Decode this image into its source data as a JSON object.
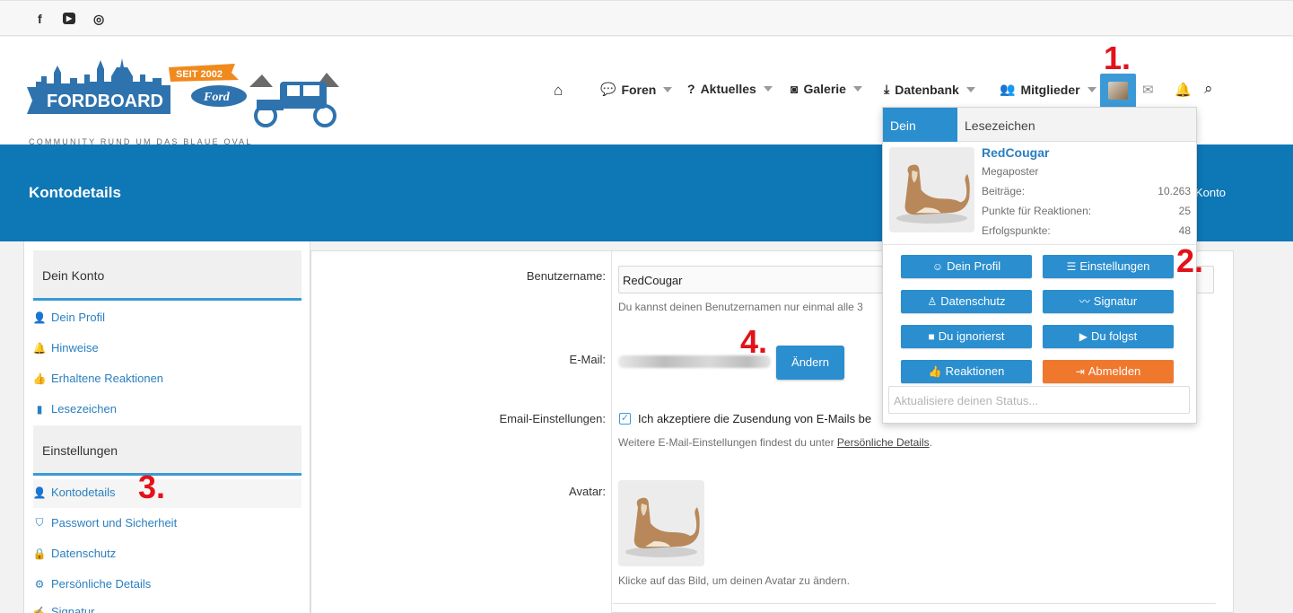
{
  "social": {
    "facebook": "f",
    "youtube": "▶",
    "instagram": "◎"
  },
  "logo": {
    "brand": "FORDBOARD",
    "ford": "Ford",
    "since": "SEIT 2002",
    "tagline": "COMMUNITY RUND UM DAS BLAUE OVAL"
  },
  "nav": {
    "home_icon": "home-icon",
    "forums": "Foren",
    "news": "Aktuelles",
    "gallery": "Galerie",
    "database": "Datenbank",
    "members": "Mitglieder"
  },
  "annotations": {
    "one": "1.",
    "two": "2.",
    "three": "3.",
    "four": "4."
  },
  "banner": {
    "title": "Kontodetails",
    "crumb": "Konto"
  },
  "sidebar": {
    "section1": "Dein Konto",
    "links1": [
      "Dein Profil",
      "Hinweise",
      "Erhaltene Reaktionen",
      "Lesezeichen"
    ],
    "section2": "Einstellungen",
    "links2": [
      "Kontodetails",
      "Passwort und Sicherheit",
      "Datenschutz",
      "Persönliche Details",
      "Signatur"
    ]
  },
  "form": {
    "username_label": "Benutzername:",
    "username_value": "RedCougar",
    "username_hint": "Du kannst deinen Benutzernamen nur einmal alle 3",
    "email_label": "E-Mail:",
    "change_button": "Ändern",
    "email_settings_label": "Email-Einstellungen:",
    "email_consent": "Ich akzeptiere die Zusendung von E-Mails be",
    "email_hint_prefix": "Weitere E-Mail-Einstellungen findest du unter ",
    "email_hint_link": "Persönliche Details",
    "email_hint_suffix": ".",
    "avatar_label": "Avatar:",
    "avatar_hint": "Klicke auf das Bild, um deinen Avatar zu ändern."
  },
  "dropdown": {
    "tab_account": "Dein Konto",
    "tab_bookmarks": "Lesezeichen",
    "username": "RedCougar",
    "user_title": "Megaposter",
    "stats": [
      {
        "label": "Beiträge:",
        "value": "10.263"
      },
      {
        "label": "Punkte für Reaktionen:",
        "value": "25"
      },
      {
        "label": "Erfolgspunkte:",
        "value": "48"
      }
    ],
    "buttons": {
      "profile": "Dein Profil",
      "settings": "Einstellungen",
      "privacy": "Datenschutz",
      "signature": "Signatur",
      "ignoring": "Du ignorierst",
      "following": "Du folgst",
      "reactions": "Reaktionen",
      "logout": "Abmelden"
    },
    "status_placeholder": "Aktualisiere deinen Status..."
  },
  "colors": {
    "primary": "#0e77b6",
    "button": "#2a8ecf",
    "orange": "#f0782d",
    "annotation": "#e2121a"
  }
}
